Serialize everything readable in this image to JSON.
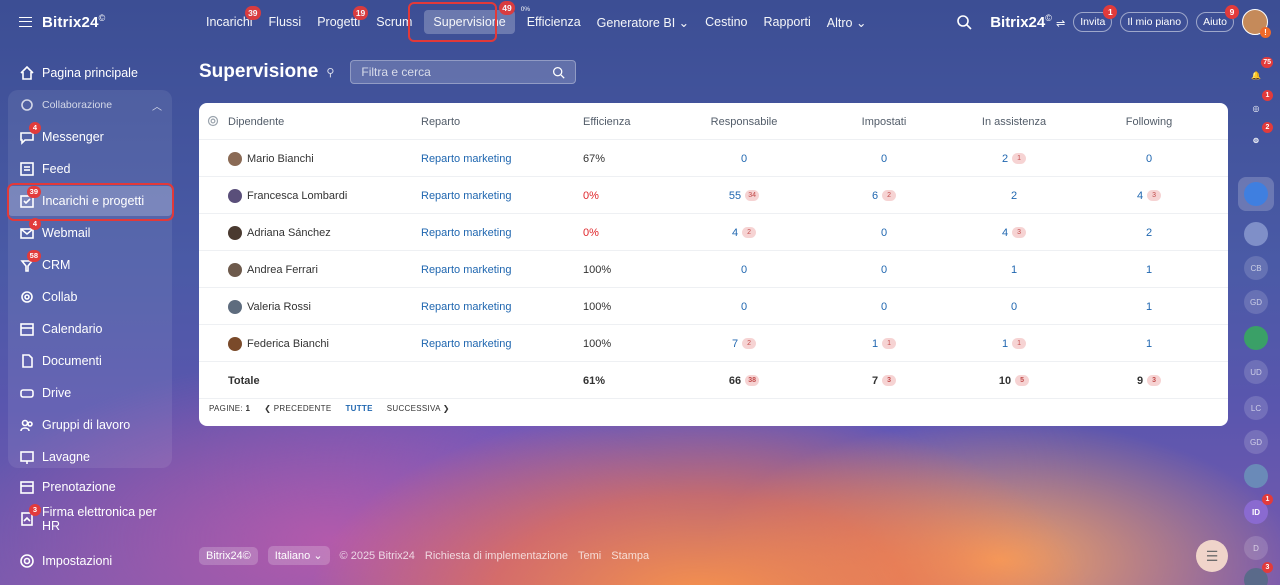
{
  "app": {
    "name": "Bitrix24",
    "copyright_symbol": "©"
  },
  "topnav": [
    {
      "label": "Incarichi",
      "badge": "39"
    },
    {
      "label": "Flussi",
      "badge": ""
    },
    {
      "label": "Progetti",
      "badge": "19"
    },
    {
      "label": "Scrum",
      "badge": ""
    },
    {
      "label": "Supervisione",
      "badge": "49"
    },
    {
      "label": "Efficienza",
      "badge": "",
      "tiny": "0%"
    },
    {
      "label": "Generatore BI ⌄",
      "badge": ""
    },
    {
      "label": "Cestino",
      "badge": ""
    },
    {
      "label": "Rapporti",
      "badge": ""
    },
    {
      "label": "Altro ⌄",
      "badge": ""
    }
  ],
  "topright": {
    "brand": "Bitrix24",
    "invite": {
      "label": "Invita",
      "badge": "1"
    },
    "plan": {
      "label": "Il mio piano"
    },
    "help": {
      "label": "Aiuto",
      "badge": "9"
    },
    "avatar_warning": "!"
  },
  "sidebar": {
    "home": "Pagina principale",
    "group": "Collaborazione",
    "items": [
      {
        "label": "Messenger",
        "badge": "4",
        "icon": "chat-icon"
      },
      {
        "label": "Feed",
        "badge": "",
        "icon": "feed-icon"
      },
      {
        "label": "Incarichi e progetti",
        "badge": "39",
        "icon": "tasks-icon"
      },
      {
        "label": "Webmail",
        "badge": "4",
        "icon": "mail-icon"
      },
      {
        "label": "CRM",
        "badge": "58",
        "icon": "crm-icon"
      },
      {
        "label": "Collab",
        "badge": "",
        "icon": "collab-icon"
      },
      {
        "label": "Calendario",
        "badge": "",
        "icon": "calendar-icon"
      },
      {
        "label": "Documenti",
        "badge": "",
        "icon": "document-icon"
      },
      {
        "label": "Drive",
        "badge": "",
        "icon": "drive-icon"
      },
      {
        "label": "Gruppi di lavoro",
        "badge": "",
        "icon": "groups-icon"
      },
      {
        "label": "Lavagne",
        "badge": "",
        "icon": "board-icon"
      }
    ],
    "booking": "Prenotazione",
    "sign_hr": {
      "label": "Firma elettronica per HR",
      "badge": "3"
    },
    "settings": "Impostazioni"
  },
  "page": {
    "title": "Supervisione",
    "search_placeholder": "Filtra e cerca"
  },
  "table": {
    "headers": {
      "employee": "Dipendente",
      "department": "Reparto",
      "efficiency": "Efficienza",
      "responsible": "Responsabile",
      "set": "Impostati",
      "assisting": "In assistenza",
      "following": "Following"
    },
    "rows": [
      {
        "name": "Mario Bianchi",
        "dept": "Reparto marketing",
        "eff": "67%",
        "eff_red": false,
        "resp": "0",
        "resp_c": "",
        "imp": "0",
        "imp_c": "",
        "ass": "2",
        "ass_c": "1",
        "fol": "0",
        "fol_c": "",
        "avatar": "#8a6a55"
      },
      {
        "name": "Francesca Lombardi",
        "dept": "Reparto marketing",
        "eff": "0%",
        "eff_red": true,
        "resp": "55",
        "resp_c": "34",
        "imp": "6",
        "imp_c": "2",
        "ass": "2",
        "ass_c": "",
        "fol": "4",
        "fol_c": "3",
        "avatar": "#5a4f7a"
      },
      {
        "name": "Adriana Sánchez",
        "dept": "Reparto marketing",
        "eff": "0%",
        "eff_red": true,
        "resp": "4",
        "resp_c": "2",
        "imp": "0",
        "imp_c": "",
        "ass": "4",
        "ass_c": "3",
        "fol": "2",
        "fol_c": "",
        "avatar": "#4a3a30"
      },
      {
        "name": "Andrea Ferrari",
        "dept": "Reparto marketing",
        "eff": "100%",
        "eff_red": false,
        "resp": "0",
        "resp_c": "",
        "imp": "0",
        "imp_c": "",
        "ass": "1",
        "ass_c": "",
        "fol": "1",
        "fol_c": "",
        "avatar": "#6d5a4c"
      },
      {
        "name": "Valeria Rossi",
        "dept": "Reparto marketing",
        "eff": "100%",
        "eff_red": false,
        "resp": "0",
        "resp_c": "",
        "imp": "0",
        "imp_c": "",
        "ass": "0",
        "ass_c": "",
        "fol": "1",
        "fol_c": "",
        "avatar": "#5e6c7e"
      },
      {
        "name": "Federica Bianchi",
        "dept": "Reparto marketing",
        "eff": "100%",
        "eff_red": false,
        "resp": "7",
        "resp_c": "2",
        "imp": "1",
        "imp_c": "1",
        "ass": "1",
        "ass_c": "1",
        "fol": "1",
        "fol_c": "",
        "avatar": "#7a4a2a"
      }
    ],
    "total": {
      "label": "Totale",
      "eff": "61%",
      "resp": "66",
      "resp_c": "38",
      "imp": "7",
      "imp_c": "3",
      "ass": "10",
      "ass_c": "5",
      "fol": "9",
      "fol_c": "3"
    },
    "pager": {
      "pages_label": "PAGINE:",
      "page": "1",
      "prev": "❮ PRECEDENTE",
      "all": "TUTTE",
      "next": "SUCCESSIVA ❯"
    }
  },
  "rightbar": {
    "items": [
      {
        "name": "notifications-icon",
        "badge": "75",
        "text": "🔔",
        "color": ""
      },
      {
        "name": "activity-icon",
        "badge": "1",
        "text": "◎",
        "color": ""
      },
      {
        "name": "copilot-icon",
        "badge": "2",
        "text": "⊜",
        "color": ""
      },
      {
        "name": "bookmark-icon",
        "badge": "",
        "text": "",
        "color": "#3f7fe0"
      },
      {
        "name": "group-chat-icon",
        "badge": "",
        "text": "",
        "color": "#7f8fc8"
      },
      {
        "name": "contact-cb",
        "badge": "",
        "text": "CB",
        "color": ""
      },
      {
        "name": "contact-gd",
        "badge": "",
        "text": "GD",
        "color": ""
      },
      {
        "name": "contact-card-icon",
        "badge": "",
        "text": "",
        "color": "#3aa067"
      },
      {
        "name": "contact-ud",
        "badge": "",
        "text": "UD",
        "color": ""
      },
      {
        "name": "contact-lc",
        "badge": "",
        "text": "LC",
        "color": ""
      },
      {
        "name": "contact-gd-2",
        "badge": "",
        "text": "GD",
        "color": ""
      },
      {
        "name": "contact-photo",
        "badge": "",
        "text": "",
        "color": "#6a8ab8"
      },
      {
        "name": "contact-id",
        "badge": "1",
        "text": "ID",
        "color": "#8a6ad0"
      },
      {
        "name": "contact-d",
        "badge": "",
        "text": "D",
        "color": ""
      },
      {
        "name": "contact-bottom",
        "badge": "3",
        "text": "",
        "color": "#5a6a8a"
      }
    ]
  },
  "footer": {
    "brand": "Bitrix24©",
    "language": "Italiano ⌄",
    "copyright": "© 2025 Bitrix24",
    "request": "Richiesta di implementazione",
    "themes": "Temi",
    "print": "Stampa"
  },
  "colors": {
    "accent": "#2067b0",
    "highlight": "#e23939",
    "negative": "#e0262b"
  }
}
